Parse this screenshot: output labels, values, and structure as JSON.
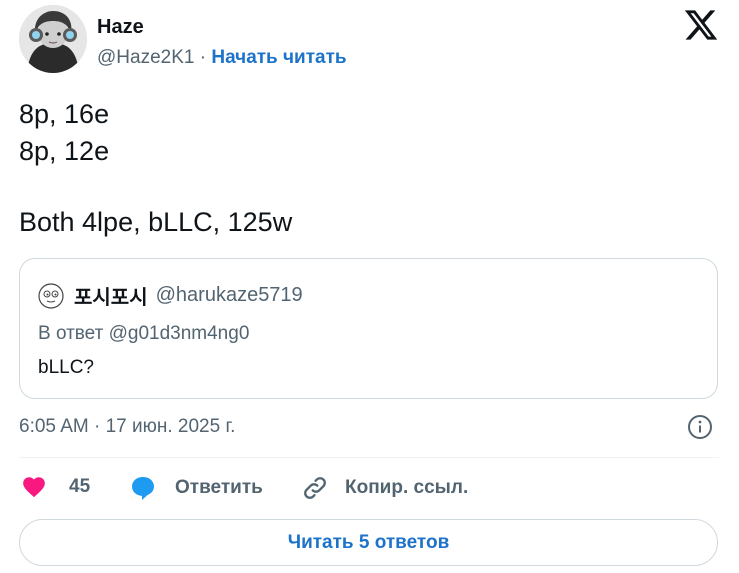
{
  "author": {
    "name": "Haze",
    "handle": "@Haze2K1",
    "separator": "·",
    "follow_label": "Начать читать"
  },
  "tweet": {
    "lines": [
      "8p, 16e",
      "8p, 12e",
      "Both 4lpe, bLLC, 125w"
    ]
  },
  "quote": {
    "name": "포시포시",
    "handle": "@harukaze5719",
    "reply_to": "В ответ @g01d3nm4ng0",
    "text": "bLLC?"
  },
  "meta": {
    "timestamp": "6:05 AM · 17 июн. 2025 г."
  },
  "actions": {
    "like_count": "45",
    "reply_label": "Ответить",
    "copy_label": "Копир. ссыл."
  },
  "read_replies_label": "Читать 5 ответов",
  "colors": {
    "accent": "#1d73c9",
    "like": "#f91880",
    "reply_icon": "#1d9bf0",
    "muted": "#536471",
    "border": "#cfd9de"
  },
  "icons": [
    "x-logo-icon",
    "heart-icon",
    "comment-icon",
    "link-icon",
    "info-icon"
  ]
}
